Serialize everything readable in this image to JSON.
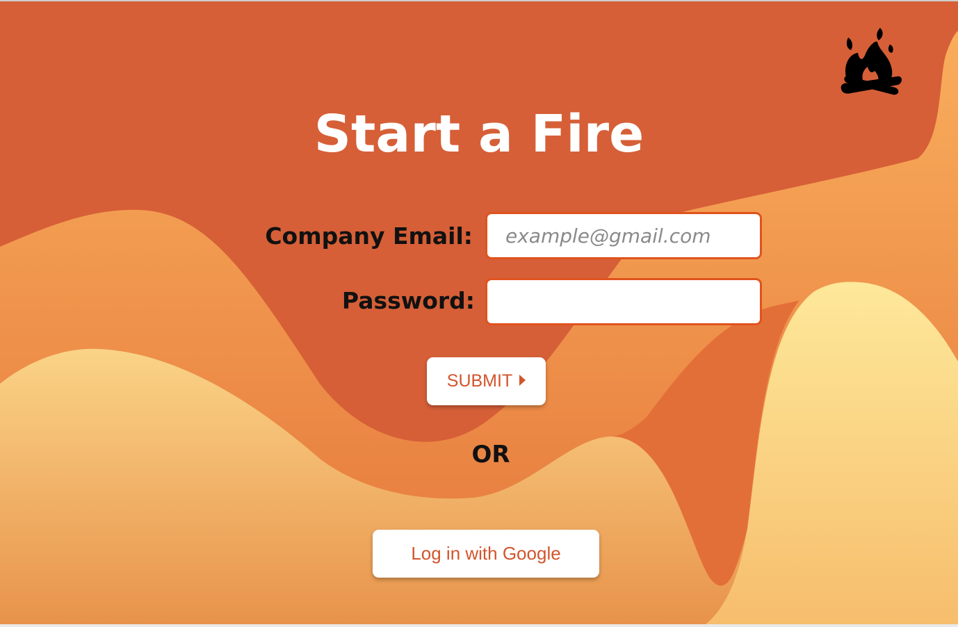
{
  "app": {
    "title": "Start a Fire",
    "logo_icon": "campfire-icon"
  },
  "form": {
    "email_label": "Company Email:",
    "email_placeholder": "example@gmail.com",
    "email_value": "",
    "password_label": "Password:",
    "password_value": "",
    "submit_label": "SUBMIT",
    "submit_icon": "caret-right-icon",
    "or_text": "OR",
    "google_label": "Log in with Google"
  },
  "colors": {
    "background_dark": "#d65f37",
    "wave_mid": "#f0974a",
    "wave_light": "#fcd37f",
    "accent": "#e0531e",
    "button_text": "#d2552c"
  }
}
